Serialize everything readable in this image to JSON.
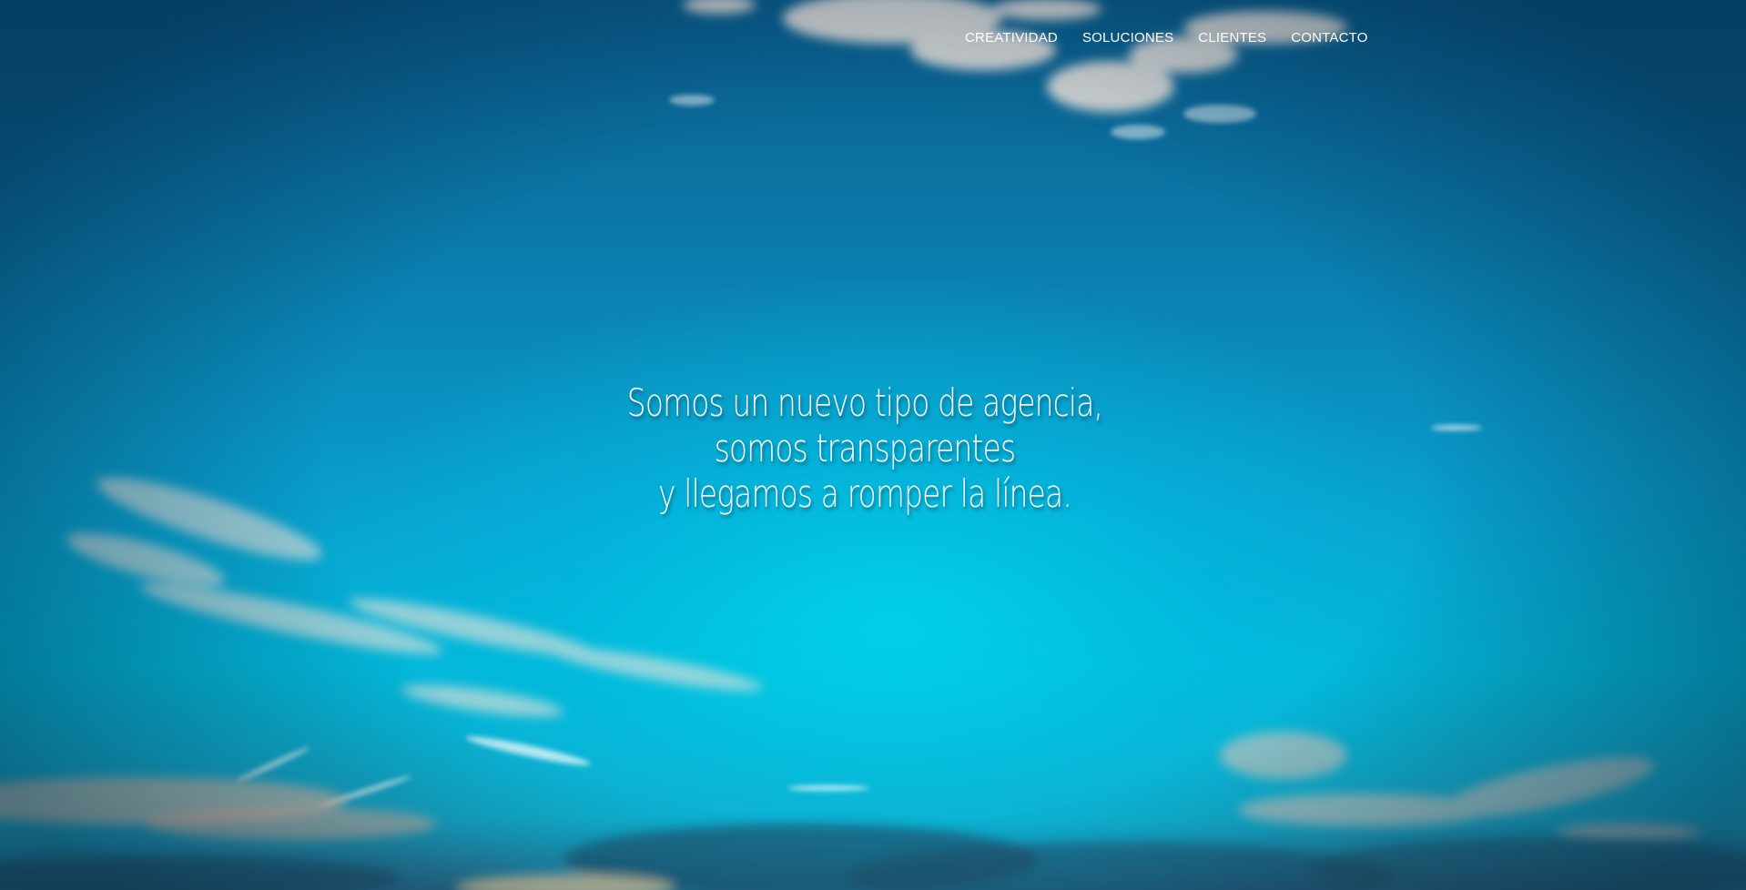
{
  "nav": {
    "items": [
      {
        "label": "CREATIVIDAD"
      },
      {
        "label": "SOLUCIONES"
      },
      {
        "label": "CLIENTES"
      },
      {
        "label": "CONTACTO"
      }
    ]
  },
  "hero": {
    "lines": [
      "Somos un nuevo tipo de agencia,",
      "somos transparentes",
      "y llegamos a romper la línea."
    ],
    "background_image": "sky-with-clouds"
  },
  "colors": {
    "text": "#ffffff",
    "sky_top": "#0a5d8c",
    "sky_middle": "#04b6d8",
    "cloud": "#f2e6dc"
  }
}
